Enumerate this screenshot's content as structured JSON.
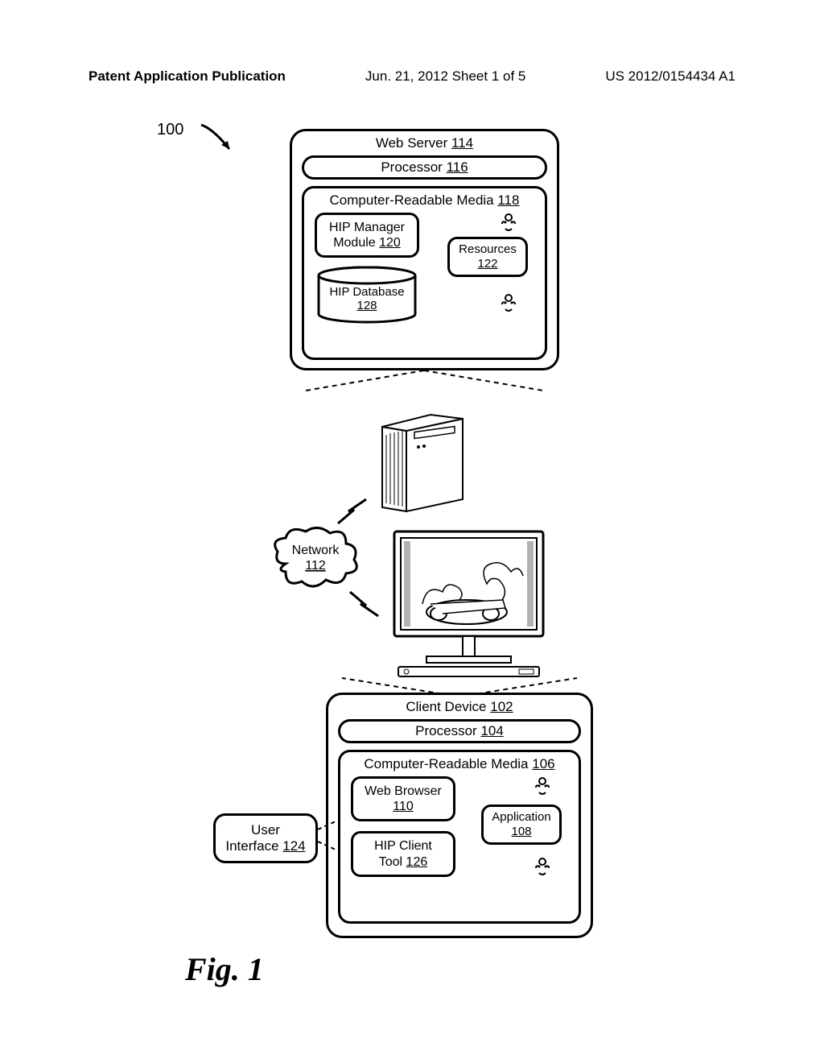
{
  "header": {
    "left": "Patent Application Publication",
    "center": "Jun. 21, 2012  Sheet 1 of 5",
    "right": "US 2012/0154434 A1"
  },
  "refNum": "100",
  "webServer": {
    "title": "Web Server",
    "titleNum": "114",
    "processor": "Processor",
    "processorNum": "116",
    "media": "Computer-Readable Media",
    "mediaNum": "118",
    "hipManager": "HIP Manager Module",
    "hipManagerNum": "120",
    "resources": "Resources",
    "resourcesNum": "122",
    "hipDatabase": "HIP Database",
    "hipDatabaseNum": "128"
  },
  "network": {
    "label": "Network",
    "num": "112"
  },
  "client": {
    "title": "Client Device",
    "titleNum": "102",
    "processor": "Processor",
    "processorNum": "104",
    "media": "Computer-Readable Media",
    "mediaNum": "106",
    "webBrowser": "Web Browser",
    "webBrowserNum": "110",
    "application": "Application",
    "applicationNum": "108",
    "hipClient": "HIP Client Tool",
    "hipClientNum": "126"
  },
  "ui": {
    "label": "User Interface",
    "num": "124"
  },
  "figLabel": "Fig. 1"
}
